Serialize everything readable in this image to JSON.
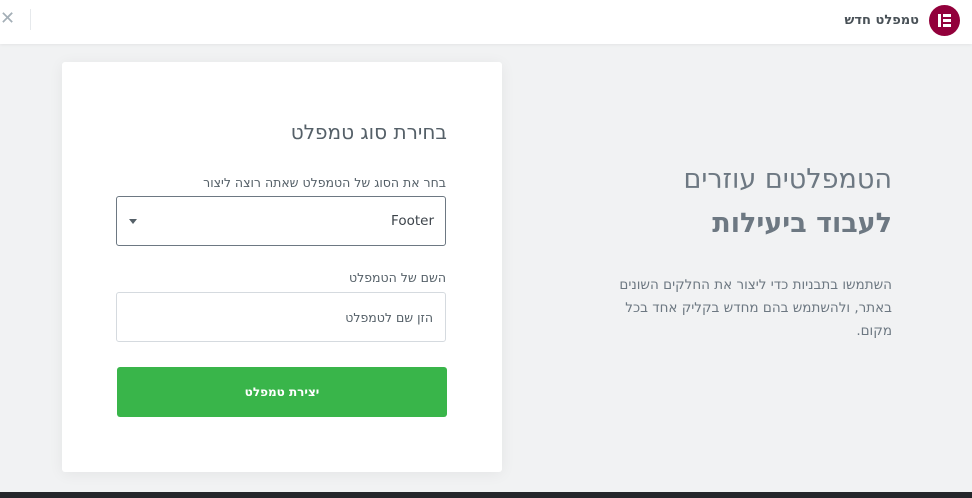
{
  "header": {
    "title": "טמפלט חדש",
    "close_glyph": "✕",
    "close_icon": "close-icon",
    "logo_icon": "elementor-logo-icon",
    "brand_color": "#92003b"
  },
  "info": {
    "line1": "הטמפלטים עוזרים",
    "line2": "לעבוד ביעילות",
    "description": "השתמשו בתבניות כדי ליצור את החלקים השונים באתר, ולהשתמש בהם מחדש בקליק אחד בכל מקום."
  },
  "form": {
    "title": "בחירת סוג טמפלט",
    "type_label": "בחר את הסוג של הטמפלט שאתה רוצה ליצור",
    "type_value": "Footer",
    "name_label": "השם של הטמפלט",
    "name_placeholder": "הזן שם לטמפלט",
    "name_value": "",
    "submit_label": "יצירת טמפלט",
    "submit_color": "#39b54a",
    "caret_icon": "caret-down-icon"
  }
}
